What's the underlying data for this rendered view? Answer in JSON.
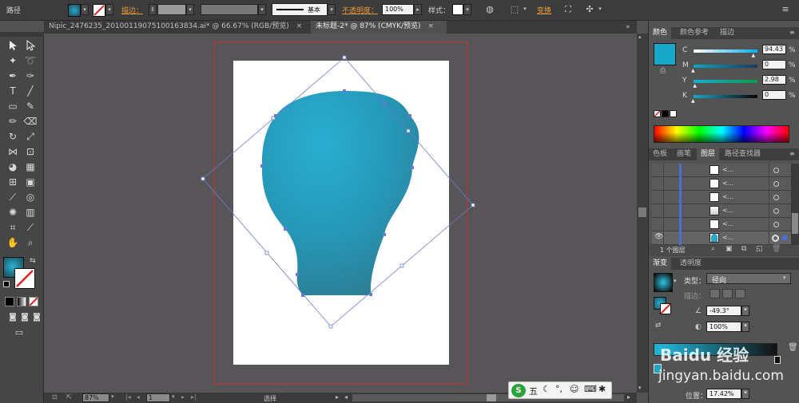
{
  "control_bar": {
    "selection_label": "路径",
    "stroke_label": "描边：",
    "stroke_profile_label": "基本",
    "opacity_label": "不透明度：",
    "opacity_value": "100%",
    "style_label": "样式：",
    "transform_label": "变换",
    "stroke_weight_value": ""
  },
  "tabs": [
    {
      "label": "Nipic_2476235_20100119075100163834.ai* @ 66.67% (RGB/预览)",
      "close": "×",
      "active": false
    },
    {
      "label": "未标题-2* @ 87% (CMYK/预览)",
      "close": "×",
      "active": true
    }
  ],
  "color_panel": {
    "tabs": [
      "颜色",
      "颜色参考",
      "描边"
    ],
    "channels": [
      {
        "name": "C",
        "value": "94.43",
        "percent": 94.43
      },
      {
        "name": "M",
        "value": "0",
        "percent": 0
      },
      {
        "name": "Y",
        "value": "2.98",
        "percent": 2.98
      },
      {
        "name": "K",
        "value": "0",
        "percent": 0
      }
    ],
    "swatch_color": "#16a8c9",
    "percent_unit": "%"
  },
  "layers_panel": {
    "tabs": [
      "色板",
      "画笔",
      "图层",
      "路径查找器"
    ],
    "rows": [
      {
        "name": "<...",
        "visible": false
      },
      {
        "name": "<...",
        "visible": false
      },
      {
        "name": "<...",
        "visible": false
      },
      {
        "name": "<...",
        "visible": false
      },
      {
        "name": "<...",
        "visible": false
      },
      {
        "name": "<...",
        "visible": true
      }
    ],
    "footer_count": "1 个图层"
  },
  "gradient_panel": {
    "tabs": [
      "渐变",
      "透明度"
    ],
    "type_label": "类型：",
    "type_value": "径向",
    "stroke_label": "描边：",
    "angle_value": "-49.3°",
    "aspect_value": "100%",
    "location_label": "位置：",
    "location_value": "17.42%",
    "watermark_text": "Baidu 经验",
    "watermark_url": "jingyan.baidu.com"
  },
  "status_bar": {
    "zoom": "87%",
    "page": "1",
    "tool_label": "选择"
  },
  "ime_bar": {
    "logo": "S",
    "mode": "五"
  },
  "colors": {
    "bulb_light": "#29aed0",
    "bulb_dark": "#2c7f96",
    "accent_orange": "#e59a36",
    "selection_blue": "#6a7bd1",
    "artboard_red": "#c8332f"
  }
}
